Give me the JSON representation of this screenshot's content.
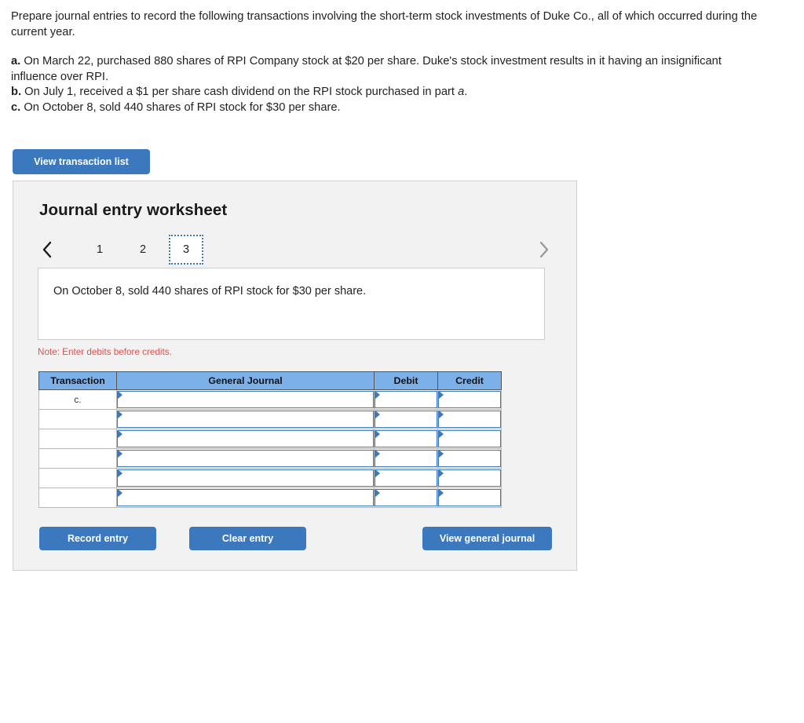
{
  "problem": {
    "intro": "Prepare journal entries to record the following transactions involving the short-term stock investments of Duke Co., all of which occurred during the current year.",
    "parts": [
      {
        "letter": "a.",
        "text_before_italic": "On March 22, purchased 880 shares of RPI Company stock at $20 per share. Duke's stock investment results in it having an insignificant influence over RPI.",
        "italic": "",
        "text_after_italic": ""
      },
      {
        "letter": "b.",
        "text_before_italic": "On July 1, received a $1 per share cash dividend on the RPI stock purchased in part ",
        "italic": "a",
        "text_after_italic": "."
      },
      {
        "letter": "c.",
        "text_before_italic": "On October 8, sold 440 shares of RPI stock for $30 per share.",
        "italic": "",
        "text_after_italic": ""
      }
    ]
  },
  "transaction_list_button": "View transaction list",
  "worksheet": {
    "title": "Journal entry worksheet",
    "pager": {
      "prev_icon": "chevron-left-icon",
      "next_icon": "chevron-right-icon",
      "tabs": [
        "1",
        "2",
        "3"
      ],
      "selected_tab": "3"
    },
    "scenario_text": "On October 8, sold 440 shares of RPI stock for $30 per share.",
    "note": "Note: Enter debits before credits.",
    "table": {
      "headers": [
        "Transaction",
        "General Journal",
        "Debit",
        "Credit"
      ],
      "rows": [
        {
          "transaction": "c.",
          "general_journal": "",
          "debit": "",
          "credit": ""
        },
        {
          "transaction": "",
          "general_journal": "",
          "debit": "",
          "credit": ""
        },
        {
          "transaction": "",
          "general_journal": "",
          "debit": "",
          "credit": ""
        },
        {
          "transaction": "",
          "general_journal": "",
          "debit": "",
          "credit": ""
        },
        {
          "transaction": "",
          "general_journal": "",
          "debit": "",
          "credit": ""
        },
        {
          "transaction": "",
          "general_journal": "",
          "debit": "",
          "credit": ""
        }
      ]
    },
    "buttons": {
      "record_entry": "Record entry",
      "clear_entry": "Clear entry",
      "view_general_journal": "View general journal"
    }
  },
  "colors": {
    "button_blue": "#3b78bd",
    "table_header_blue": "#7cb0e8",
    "panel_gray": "#f2f2f2",
    "note_red": "#d9534f"
  }
}
